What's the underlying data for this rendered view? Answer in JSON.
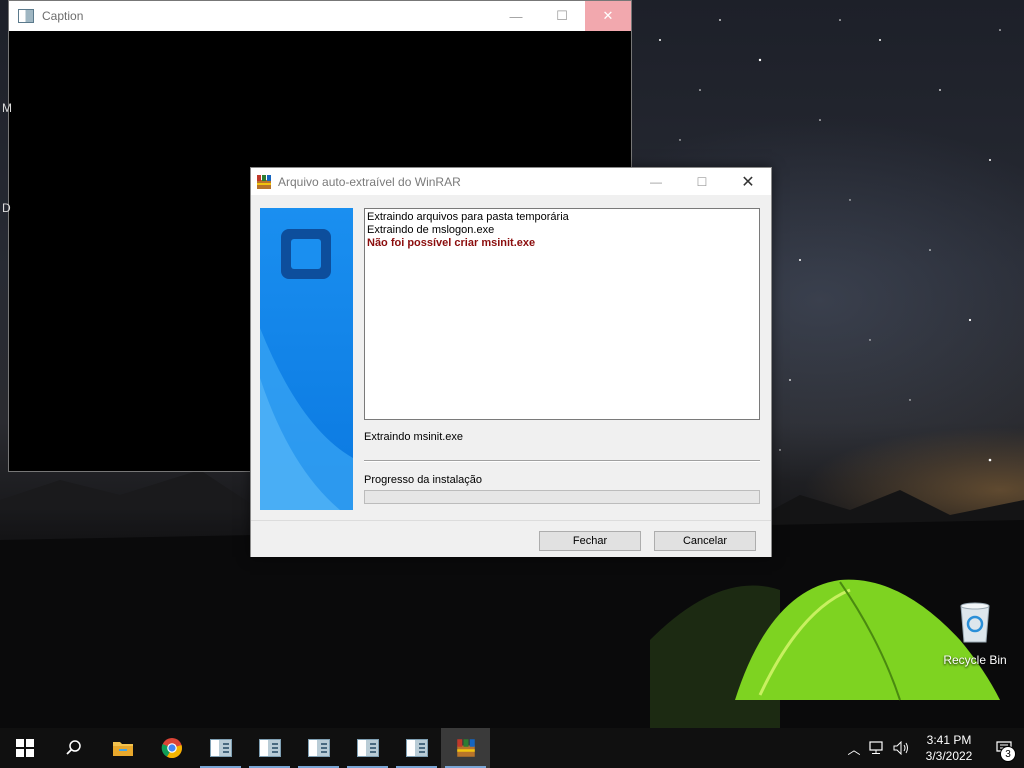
{
  "caption_window": {
    "title": "Caption",
    "side_letters": [
      "M",
      "D"
    ]
  },
  "dialog": {
    "title": "Arquivo auto-extraível do WinRAR",
    "log_lines": [
      {
        "text": "Extraindo arquivos para pasta temporária",
        "error": false
      },
      {
        "text": "Extraindo de mslogon.exe",
        "error": false
      },
      {
        "text": "Não foi possível criar msinit.exe",
        "error": true
      }
    ],
    "status": "Extraindo msinit.exe",
    "progress_label": "Progresso da instalação",
    "progress_fraction": 0,
    "buttons": {
      "close": "Fechar",
      "cancel": "Cancelar"
    }
  },
  "desktop": {
    "recycle_bin_label": "Recycle Bin"
  },
  "taskbar": {
    "items": [
      "start-icon",
      "search-icon",
      "file-explorer-icon",
      "chrome-icon",
      "app-window-icon",
      "app-window-icon",
      "app-window-icon",
      "app-window-icon",
      "app-window-icon",
      "winrar-icon"
    ],
    "clock": {
      "time": "3:41 PM",
      "date": "3/3/2022"
    },
    "notification_count": "3"
  },
  "colors": {
    "error_text": "#8b0d0d",
    "banner_blue": "#1e8ff0",
    "taskbar": "#101010"
  }
}
